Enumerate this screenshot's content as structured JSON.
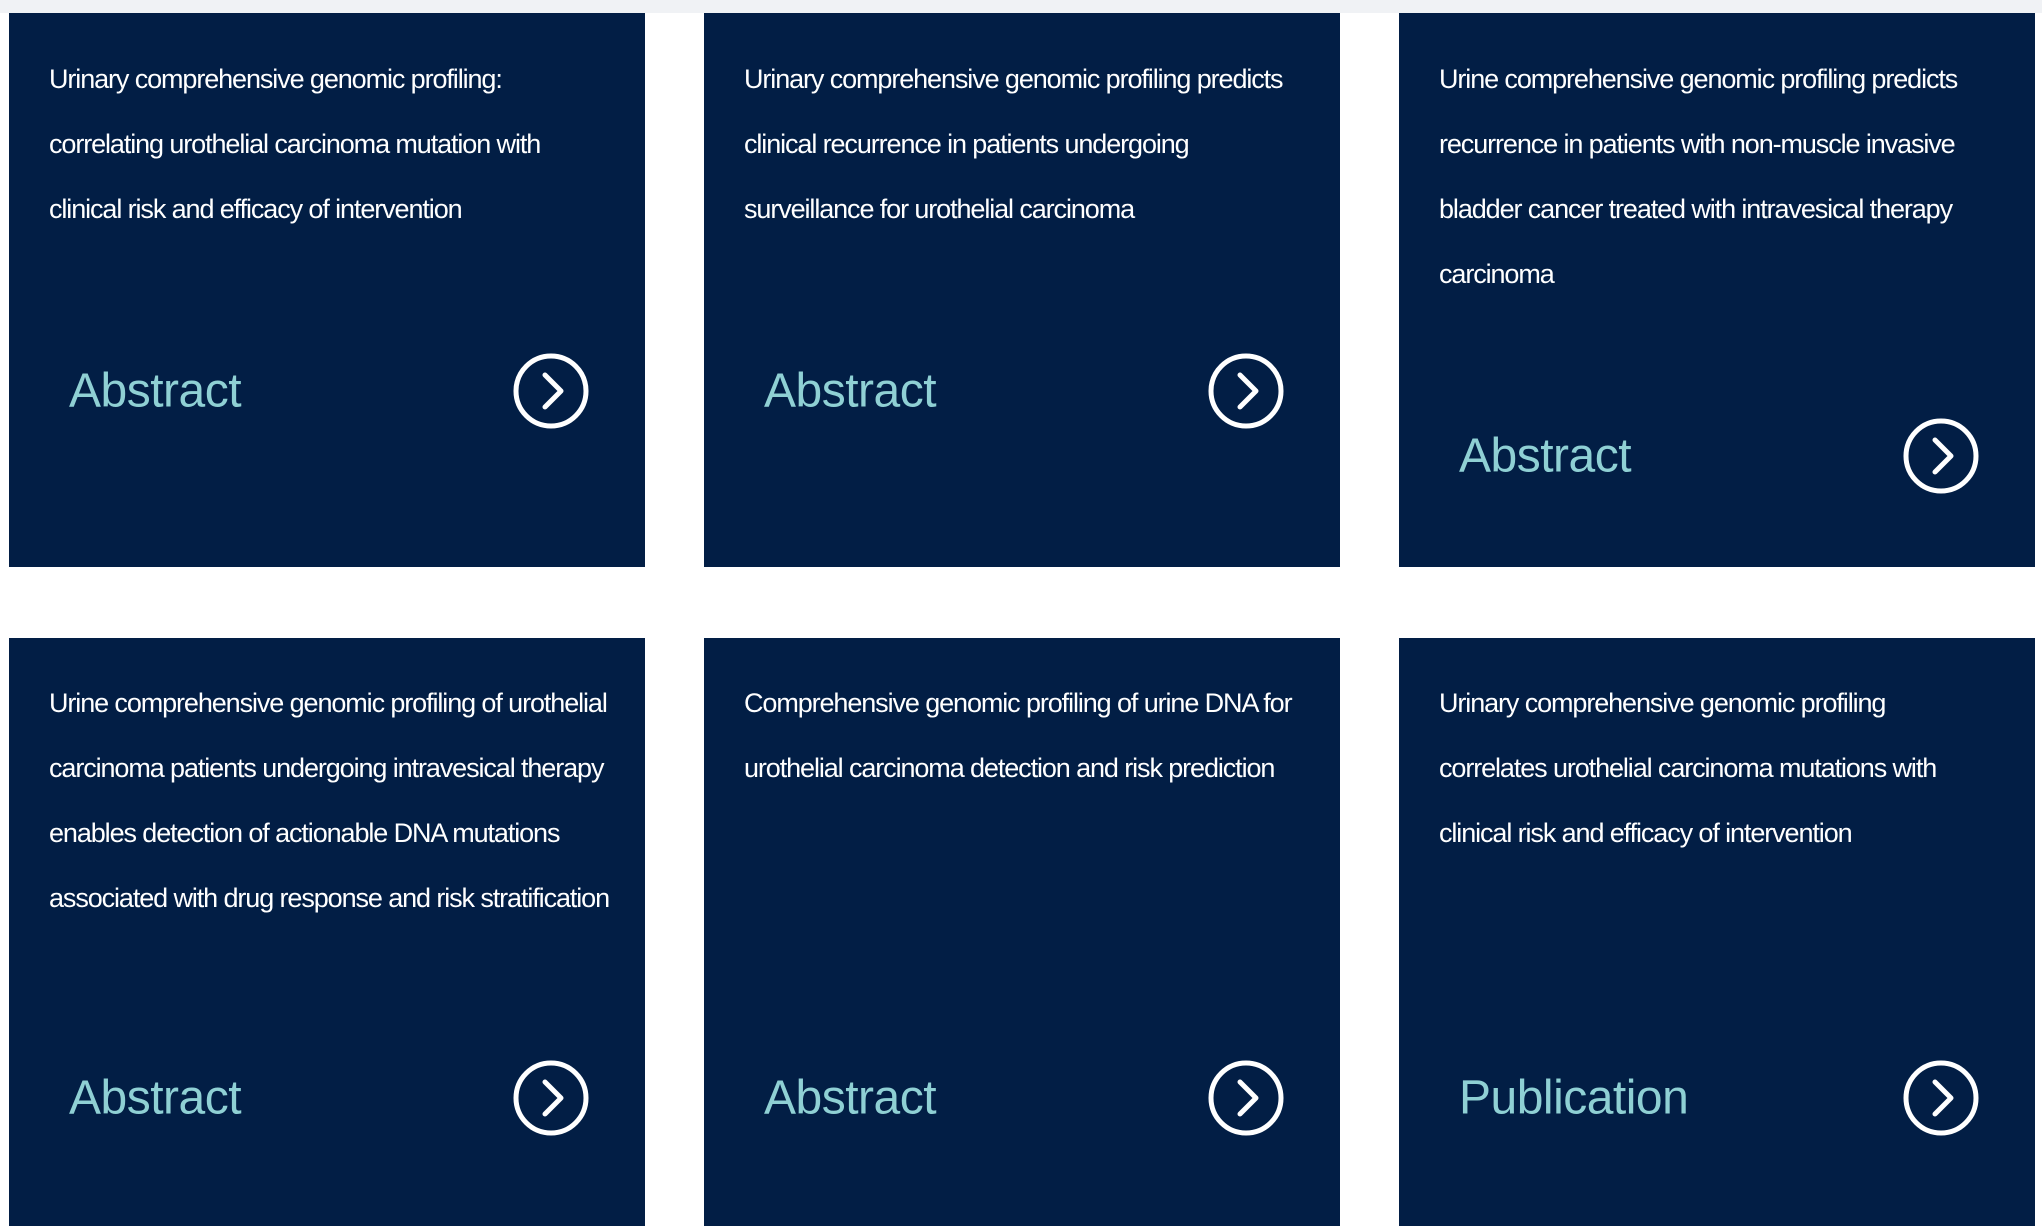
{
  "colors": {
    "card_background": "#021e45",
    "title_text": "#ffffff",
    "type_label": "#8fd0d4",
    "arrow_icon": "#ffffff",
    "page_background": "#ffffff"
  },
  "cards": [
    {
      "title": "Urinary comprehensive genomic profiling: correlating urothelial carcinoma mutation with clinical risk and efficacy of intervention",
      "type": "Abstract",
      "icon": "chevron-right-circle-icon"
    },
    {
      "title": "Urinary comprehensive genomic profiling predicts clinical recurrence in patients undergoing surveillance for urothelial carcinoma",
      "type": "Abstract",
      "icon": "chevron-right-circle-icon"
    },
    {
      "title": "Urine comprehensive genomic profiling predicts recurrence in patients with non-muscle invasive bladder cancer treated with intravesical therapy carcinoma",
      "type": "Abstract",
      "icon": "chevron-right-circle-icon"
    },
    {
      "title": "Urine comprehensive genomic profiling of urothelial carcinoma patients undergoing intravesical therapy enables detection of actionable DNA mutations associated with drug response and risk stratification",
      "type": "Abstract",
      "icon": "chevron-right-circle-icon"
    },
    {
      "title": "Comprehensive genomic profiling of urine DNA for urothelial carcinoma detection and risk prediction",
      "type": "Abstract",
      "icon": "chevron-right-circle-icon"
    },
    {
      "title": "Urinary comprehensive genomic profiling correlates urothelial carcinoma mutations with clinical risk and efficacy of intervention",
      "type": "Publication",
      "icon": "chevron-right-circle-icon"
    }
  ]
}
